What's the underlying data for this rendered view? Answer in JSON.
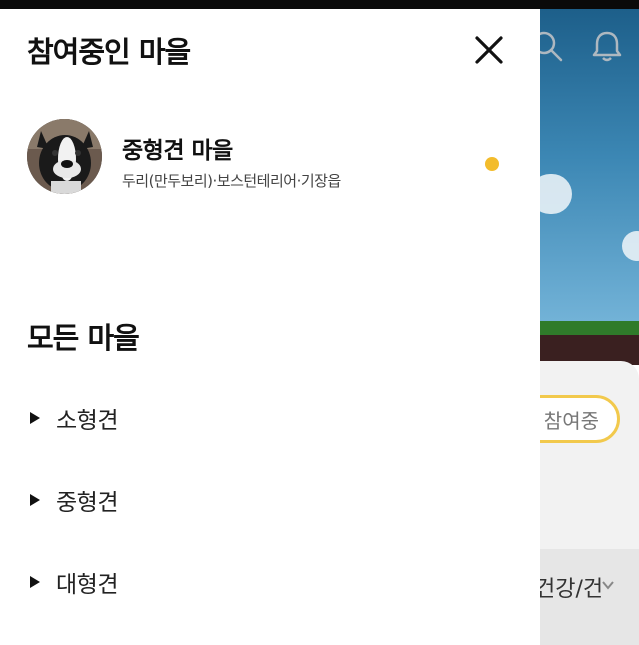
{
  "drawer": {
    "title": "참여중인 마을",
    "joined_village": {
      "name": "중형견 마을",
      "description": "두리(만두보리)·보스턴테리어·기장읍",
      "status_color": "#f3bc2c"
    },
    "all_villages_title": "모든 마을",
    "categories": [
      {
        "label": "소형견"
      },
      {
        "label": "중형견"
      },
      {
        "label": "대형견"
      }
    ]
  },
  "background": {
    "join_button_label": "참여중",
    "health_label": "건강/건"
  },
  "colors": {
    "accent": "#f3bc2c",
    "sky": "#2c78a6"
  },
  "icons": [
    "close-icon",
    "search-icon",
    "bell-icon",
    "triangle-right-icon",
    "chevron-down-icon"
  ]
}
